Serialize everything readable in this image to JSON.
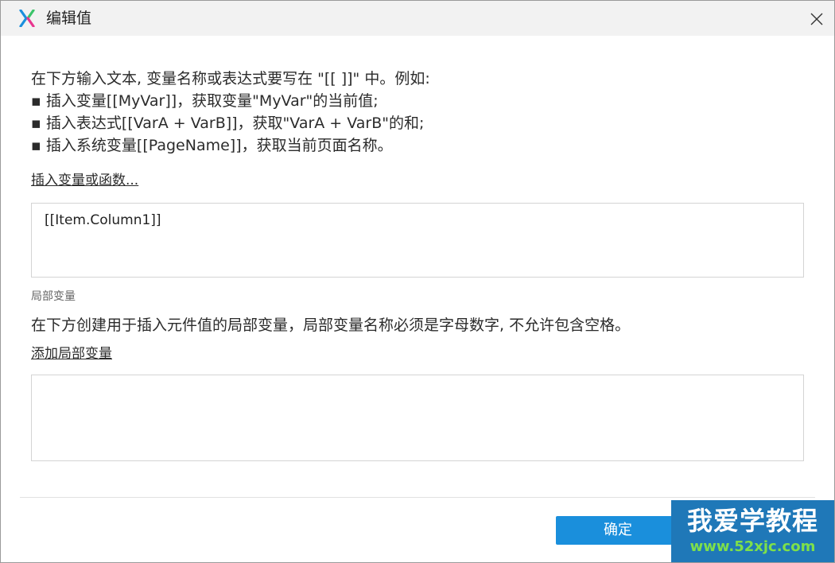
{
  "titlebar": {
    "title": "编辑值",
    "logo_icon": "x-logo-icon",
    "close_icon": "close-icon"
  },
  "intro": {
    "lines": [
      "在下方输入文本, 变量名称或表达式要写在 \"[[ ]]\" 中。例如:",
      "▪ 插入变量[[MyVar]]，获取变量\"MyVar\"的当前值;",
      "▪ 插入表达式[[VarA + VarB]]，获取\"VarA + VarB\"的和;",
      "▪ 插入系统变量[[PageName]]，获取当前页面名称。"
    ]
  },
  "insert_link": "插入变量或函数...",
  "value_input": {
    "value": "[[Item.Column1]]"
  },
  "local_vars": {
    "section_label": "局部变量",
    "description": "在下方创建用于插入元件值的局部变量，局部变量名称必须是字母数字, 不允许包含空格。",
    "add_link": "添加局部变量"
  },
  "footer": {
    "ok_label": "确定"
  },
  "watermark": {
    "title": "我爱学教程",
    "url": "www.52xjc.com"
  },
  "colors": {
    "accent": "#1a8fdc",
    "watermark_bg": "#1f78b8",
    "watermark_url": "#7ee04a"
  }
}
